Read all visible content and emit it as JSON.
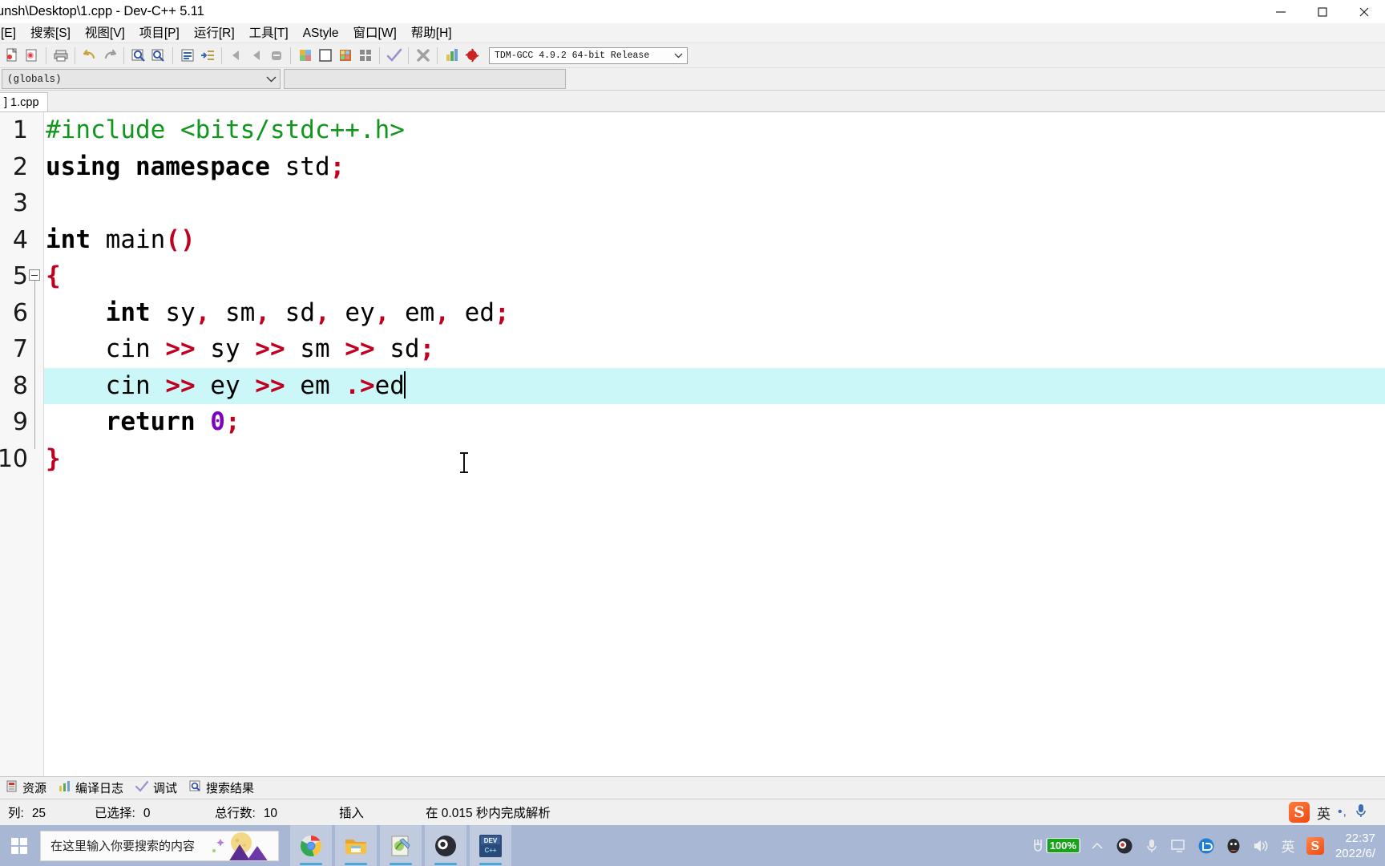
{
  "window": {
    "title": "unsh\\Desktop\\1.cpp - Dev-C++ 5.11",
    "minimize_label": "─",
    "maximize_label": "□",
    "close_label": "✕"
  },
  "menubar": {
    "items": [
      {
        "label": "[E]",
        "name": "menu-edit"
      },
      {
        "label": "搜索[S]",
        "name": "menu-search"
      },
      {
        "label": "视图[V]",
        "name": "menu-view"
      },
      {
        "label": "项目[P]",
        "name": "menu-project"
      },
      {
        "label": "运行[R]",
        "name": "menu-run"
      },
      {
        "label": "工具[T]",
        "name": "menu-tools"
      },
      {
        "label": "AStyle",
        "name": "menu-astyle"
      },
      {
        "label": "窗口[W]",
        "name": "menu-window"
      },
      {
        "label": "帮助[H]",
        "name": "menu-help"
      }
    ]
  },
  "toolbar": {
    "compiler_select": "TDM-GCC 4.9.2 64-bit Release",
    "icons": [
      "new-file-icon",
      "open-file-icon",
      "save-icon",
      "save-all-icon",
      "close-file-icon",
      "print-icon",
      "undo-icon",
      "redo-icon",
      "find-icon",
      "replace-icon",
      "goto-line-icon",
      "goto-function-icon",
      "step-back-icon",
      "step-forward-icon",
      "stop-icon",
      "compile-icon",
      "run-icon",
      "compile-run-icon",
      "rebuild-icon",
      "syntax-check-icon",
      "remove-icon",
      "profile-icon",
      "debug-icon"
    ]
  },
  "classbrowser": {
    "scope_value": "(globals)",
    "member_value": ""
  },
  "editor": {
    "tab_label": "] 1.cpp",
    "current_line": 8,
    "lines": [
      {
        "n": "1",
        "tokens": [
          {
            "t": "pre",
            "v": "#include <bits/stdc++.h>"
          }
        ]
      },
      {
        "n": "2",
        "tokens": [
          {
            "t": "kw",
            "v": "using namespace"
          },
          {
            "t": "id",
            "v": " std"
          },
          {
            "t": "punct",
            "v": ";"
          }
        ]
      },
      {
        "n": "3",
        "tokens": [
          {
            "t": "id",
            "v": ""
          }
        ]
      },
      {
        "n": "4",
        "tokens": [
          {
            "t": "kw",
            "v": "int"
          },
          {
            "t": "id",
            "v": " main"
          },
          {
            "t": "punct",
            "v": "()"
          }
        ]
      },
      {
        "n": "5",
        "tokens": [
          {
            "t": "punct",
            "v": "{"
          }
        ]
      },
      {
        "n": "6",
        "tokens": [
          {
            "t": "kw",
            "v": "    int"
          },
          {
            "t": "id",
            "v": " sy"
          },
          {
            "t": "punct",
            "v": ","
          },
          {
            "t": "id",
            "v": " sm"
          },
          {
            "t": "punct",
            "v": ","
          },
          {
            "t": "id",
            "v": " sd"
          },
          {
            "t": "punct",
            "v": ","
          },
          {
            "t": "id",
            "v": " ey"
          },
          {
            "t": "punct",
            "v": ","
          },
          {
            "t": "id",
            "v": " em"
          },
          {
            "t": "punct",
            "v": ","
          },
          {
            "t": "id",
            "v": " ed"
          },
          {
            "t": "punct",
            "v": ";"
          }
        ]
      },
      {
        "n": "7",
        "tokens": [
          {
            "t": "id",
            "v": "    cin "
          },
          {
            "t": "punct",
            "v": ">>"
          },
          {
            "t": "id",
            "v": " sy "
          },
          {
            "t": "punct",
            "v": ">>"
          },
          {
            "t": "id",
            "v": " sm "
          },
          {
            "t": "punct",
            "v": ">>"
          },
          {
            "t": "id",
            "v": " sd"
          },
          {
            "t": "punct",
            "v": ";"
          }
        ]
      },
      {
        "n": "8",
        "tokens": [
          {
            "t": "id",
            "v": "    cin "
          },
          {
            "t": "punct",
            "v": ">>"
          },
          {
            "t": "id",
            "v": " ey "
          },
          {
            "t": "punct",
            "v": ">>"
          },
          {
            "t": "id",
            "v": " em "
          },
          {
            "t": "punct",
            "v": ".>"
          },
          {
            "t": "id",
            "v": "ed"
          }
        ]
      },
      {
        "n": "9",
        "tokens": [
          {
            "t": "kw",
            "v": "    return"
          },
          {
            "t": "num",
            "v": " 0"
          },
          {
            "t": "punct",
            "v": ";"
          }
        ]
      },
      {
        "n": "10",
        "tokens": [
          {
            "t": "punct",
            "v": "}"
          }
        ]
      }
    ]
  },
  "bottom_panel": {
    "tabs": [
      {
        "label": "资源",
        "icon": "resource-icon"
      },
      {
        "label": "编译日志",
        "icon": "compile-log-icon"
      },
      {
        "label": "调试",
        "icon": "debug-check-icon"
      },
      {
        "label": "搜索结果",
        "icon": "search-results-icon"
      }
    ]
  },
  "statusbar": {
    "col_label": "列:",
    "col_value": "25",
    "selected_label": "已选择:",
    "selected_value": "0",
    "lines_label": "总行数:",
    "lines_value": "10",
    "mode": "插入",
    "parse_status": "在 0.015 秒内完成解析"
  },
  "ime_float": {
    "logo": "S",
    "mode": "英",
    "dots": "•,",
    "mic": "mic-icon"
  },
  "taskbar": {
    "search_placeholder": "在这里输入你要搜索的内容",
    "apps": [
      {
        "name": "taskbar-chrome",
        "label": "Chrome",
        "active": true
      },
      {
        "name": "taskbar-explorer",
        "label": "文件资源管理器",
        "active": true
      },
      {
        "name": "taskbar-editor",
        "label": "编辑器",
        "active": true
      },
      {
        "name": "taskbar-obs",
        "label": "OBS Studio",
        "active": true
      },
      {
        "name": "taskbar-devcpp",
        "label": "Dev-C++",
        "active": true
      }
    ],
    "tray": [
      {
        "name": "battery-icon",
        "label": "100%"
      },
      {
        "name": "chevron-up-icon",
        "label": "^"
      },
      {
        "name": "obs-tray-icon",
        "label": "OBS"
      },
      {
        "name": "mic-tray-icon",
        "label": "麦克风"
      },
      {
        "name": "display-tray-icon",
        "label": "显示"
      },
      {
        "name": "lens-tray-icon",
        "label": "L"
      },
      {
        "name": "qq-tray-icon",
        "label": "QQ"
      },
      {
        "name": "volume-tray-icon",
        "label": "音量"
      },
      {
        "name": "ime-tray-icon",
        "label": "英"
      },
      {
        "name": "sogou-tray-icon",
        "label": "S"
      }
    ],
    "clock_time": "22:37",
    "clock_date": "2022/6/"
  },
  "colors": {
    "current_line": "#ccf7f8",
    "preprocessor": "#12961e",
    "punctuation": "#c00020",
    "number": "#8000c0",
    "taskbar": "#a8b8d4",
    "battery_green": "#19a319"
  }
}
